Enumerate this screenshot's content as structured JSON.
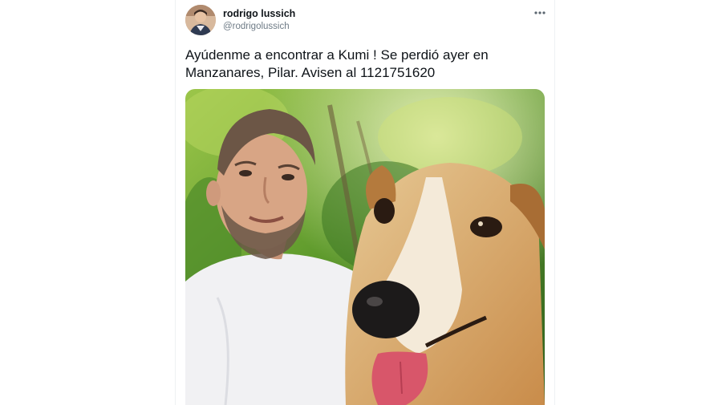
{
  "tweet": {
    "author_name": "rodrigo lussich",
    "author_handle": "@rodrigolussich",
    "text_line_1": "Ayúdenme a encontrar a Kumi ! Se perdió ayer en",
    "text_line_2": "Manzanares, Pilar. Avisen al 1121751620",
    "more_icon": "ellipsis-horizontal-icon",
    "avatar_icon": "profile-photo",
    "photo_description_icon": "selfie-with-dog-photo"
  },
  "colors": {
    "name": "#0f1419",
    "handle": "#6e7b86",
    "more_icon": "#5b6670"
  }
}
